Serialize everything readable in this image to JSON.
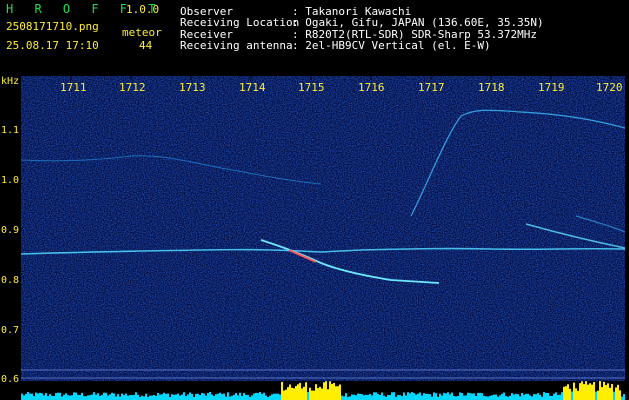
{
  "header": {
    "logo": "H R O F F T",
    "version": "1.0.0",
    "filename": "2508171710.png",
    "datetime": "25.08.17 17:10",
    "meteor_label": "meteor",
    "meteor_count": "44",
    "observer_label": "Observer",
    "observer_value": ": Takanori Kawachi",
    "location_label": "Receiving Location",
    "location_value": ": Ogaki, Gifu, JAPAN (136.60E, 35.35N)",
    "receiver_label": "Receiver",
    "receiver_value": ": R820T2(RTL-SDR) SDR-Sharp 53.372MHz",
    "antenna_label": "Receiving antenna",
    "antenna_value": ": 2el-HB9CV Vertical (el. E-W)"
  },
  "axes": {
    "y_unit": "kHz",
    "y_ticks": [
      "1.1",
      "1.0",
      "0.9",
      "0.8",
      "0.7",
      "0.6"
    ],
    "x_ticks": [
      "1711",
      "1712",
      "1713",
      "1714",
      "1715",
      "1716",
      "1717",
      "1718",
      "1719",
      "1720"
    ]
  },
  "colors": {
    "text_yellow": "#ffee33",
    "logo_green": "#19e04a",
    "noise_blue": "#0a1f8a",
    "trace_cyan": "#40e0ff",
    "level_yellow": "#ffee00",
    "level_cyan": "#00d8ff"
  }
}
